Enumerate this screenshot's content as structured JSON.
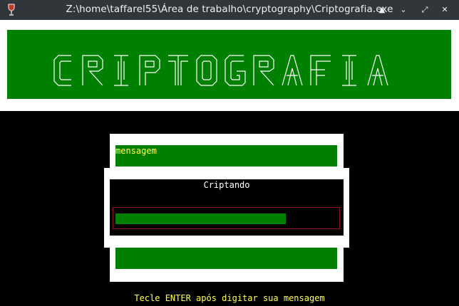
{
  "window": {
    "title": "Z:\\home\\taffarel55\\Área de trabalho\\cryptography\\Criptografia.exe",
    "app_icon": "wine-glass-icon",
    "buttons": {
      "keep_above": "▲",
      "minimize": "⌄",
      "maximize": "⤢",
      "close": "✕"
    }
  },
  "banner": {
    "text": "CRIPTOGRAFIA",
    "style": "ascii-art",
    "background": "#008000",
    "foreground": "#ffffff"
  },
  "message_box": {
    "label": "mensagem",
    "field_color": "#008000",
    "label_color": "#ffff55"
  },
  "dialog": {
    "title": "Criptando",
    "progress": 0.77,
    "progress_color": "#008000",
    "border_color": "#8b1a1a"
  },
  "hint": "Tecle ENTER após digitar sua mensagem"
}
